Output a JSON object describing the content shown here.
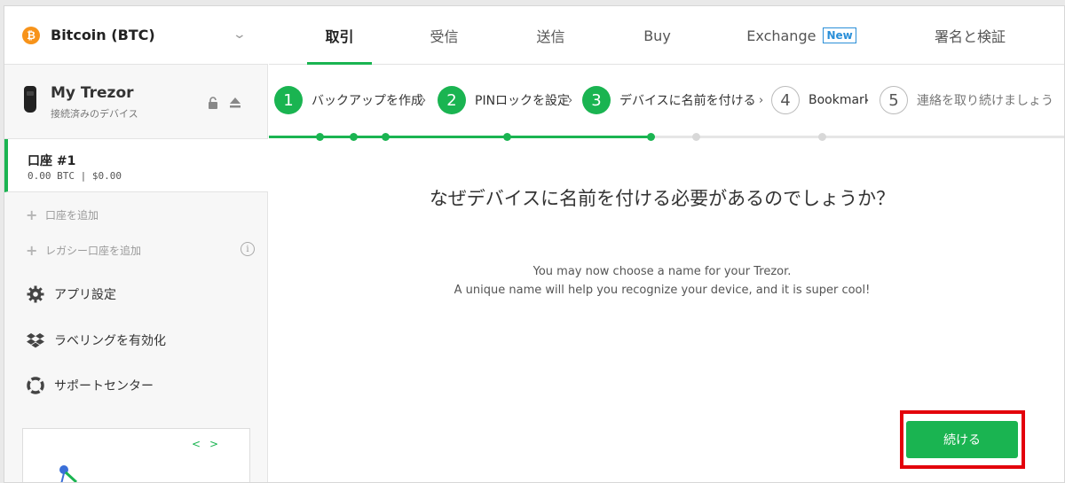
{
  "sidebar": {
    "coin": {
      "symbol": "₿",
      "name": "Bitcoin (BTC)"
    },
    "device": {
      "name": "My Trezor",
      "status": "接続済みのデバイス"
    },
    "account": {
      "name": "口座 #1",
      "balance": "0.00 BTC | $0.00"
    },
    "add_account": "口座を追加",
    "add_legacy_account": "レガシー口座を追加",
    "menu": [
      {
        "label": "アプリ設定",
        "icon": "gear-icon"
      },
      {
        "label": "ラベリングを有効化",
        "icon": "dropbox-icon"
      },
      {
        "label": "サポートセンター",
        "icon": "lifebuoy-icon"
      }
    ],
    "promo_nav": "<>"
  },
  "tabs": [
    {
      "label": "取引",
      "active": true
    },
    {
      "label": "受信"
    },
    {
      "label": "送信"
    },
    {
      "label": "Buy"
    },
    {
      "label": "Exchange",
      "badge": "New"
    },
    {
      "label": "署名と検証"
    }
  ],
  "steps": [
    {
      "num": "1",
      "label": "バックアップを作成",
      "done": true
    },
    {
      "num": "2",
      "label": "PINロックを設定",
      "done": true
    },
    {
      "num": "3",
      "label": "デバイスに名前を付ける",
      "done": true
    },
    {
      "num": "4",
      "label": "Bookmark",
      "done": false
    },
    {
      "num": "5",
      "label": "連絡を取り続けましょう",
      "done": false
    }
  ],
  "main": {
    "heading": "なぜデバイスに名前を付ける必要があるのでしょうか？",
    "description_line1": "You may now choose a name for your Trezor.",
    "description_line2": "A unique name will help you recognize your device, and it is super cool!",
    "continue_label": "続ける"
  },
  "colors": {
    "accent": "#1ab451",
    "bitcoin": "#f7931a",
    "badge": "#2a8fd8",
    "highlight": "#e3000b"
  }
}
